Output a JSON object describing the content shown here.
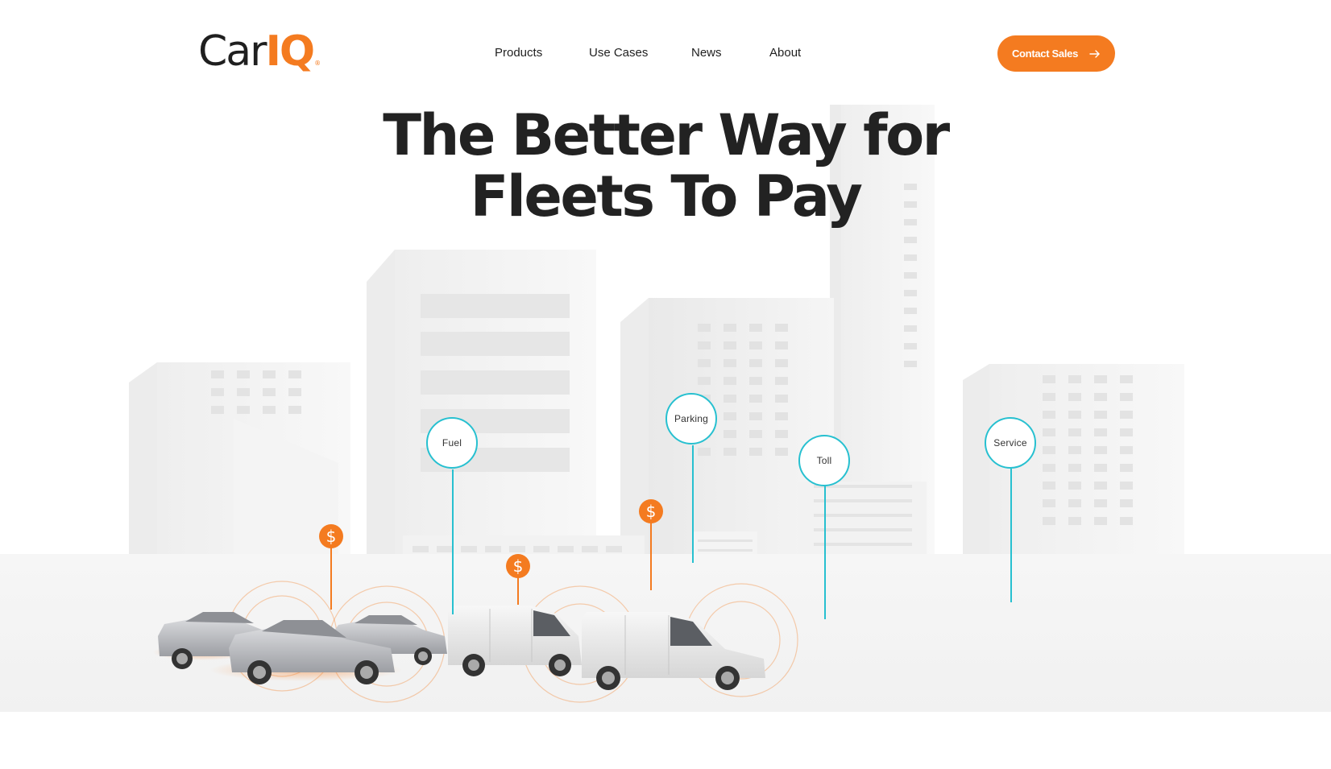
{
  "header": {
    "logo_primary": "Car",
    "logo_accent": "IQ",
    "nav": [
      "Products",
      "Use Cases",
      "News",
      "About"
    ],
    "cta_label": "Contact Sales"
  },
  "hero": {
    "title_line1": "The Better Way for",
    "title_line2": "Fleets To Pay"
  },
  "scene": {
    "categories": [
      "Fuel",
      "Parking",
      "Toll",
      "Service"
    ],
    "coin_symbol": "$"
  },
  "colors": {
    "accent": "#f47b20",
    "pin": "#27c0d0",
    "text": "#1f1f1f"
  }
}
